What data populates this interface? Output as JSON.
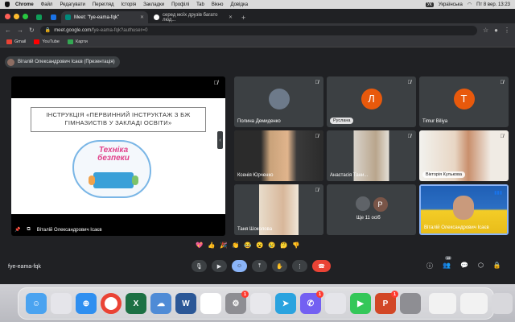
{
  "menubar": {
    "items": [
      "Chrome",
      "Файл",
      "Редагувати",
      "Перегляд",
      "Історія",
      "Закладки",
      "Профілі",
      "Tab",
      "Вікно",
      "Довідка"
    ],
    "lang_badge": "УК",
    "lang": "Українська",
    "clock": "Пт 8 вер. 13:23"
  },
  "tabs": [
    {
      "title": "Meet: \"fye-eama-fqk\"",
      "active": true
    },
    {
      "title": "серед моїх друзів багато люд...",
      "active": false
    }
  ],
  "address": {
    "host": "meet.google.com",
    "path": "/fye-eama-fqk?authuser=0"
  },
  "bookmarks": [
    "Gmail",
    "YouTube",
    "Карти"
  ],
  "presenter_label": "Віталій Олександрович Ісаєв (Презентація)",
  "slide": {
    "title": "ІНСТРУКЦІЯ «ПЕРВИННИЙ ІНСТРУКТАЖ З БЖ ГІМНАЗИСТІВ У ЗАКЛАДІ ОСВІТИ»",
    "image_text": "Техніка безпеки"
  },
  "stage_name": "Віталій Олександрович Ісаєв",
  "participants": [
    {
      "name": "Полина Демиденко",
      "initial": "",
      "color": "#3c4043"
    },
    {
      "name": "Руслана",
      "initial": "Л",
      "color": "#e8590c"
    },
    {
      "name": "Timur Biliya",
      "initial": "T",
      "color": "#e8590c"
    },
    {
      "name": "Ксенія Юрченко",
      "initial": "",
      "color": "#3c4043"
    },
    {
      "name": "Анастасія Тани...",
      "initial": "",
      "color": "#3c4043"
    },
    {
      "name": "Вікторія Кулькова",
      "initial": "",
      "color": "#3c4043"
    },
    {
      "name": "Таня Шоколова",
      "initial": "",
      "color": "#3c4043"
    },
    {
      "name": "Ще 11 осіб",
      "initial": "P",
      "color": "#795548"
    },
    {
      "name": "Віталій Олександрович Ісаєв",
      "initial": "",
      "color": "#3c4043"
    }
  ],
  "reactions": [
    "💖",
    "👍",
    "🎉",
    "👏",
    "😂",
    "😮",
    "😢",
    "🤔",
    "👎"
  ],
  "meeting_code": "fye-eama-fqk",
  "people_count": "19",
  "dock_badges": {
    "settings": "1",
    "viber": "1",
    "powerpoint": "1"
  }
}
